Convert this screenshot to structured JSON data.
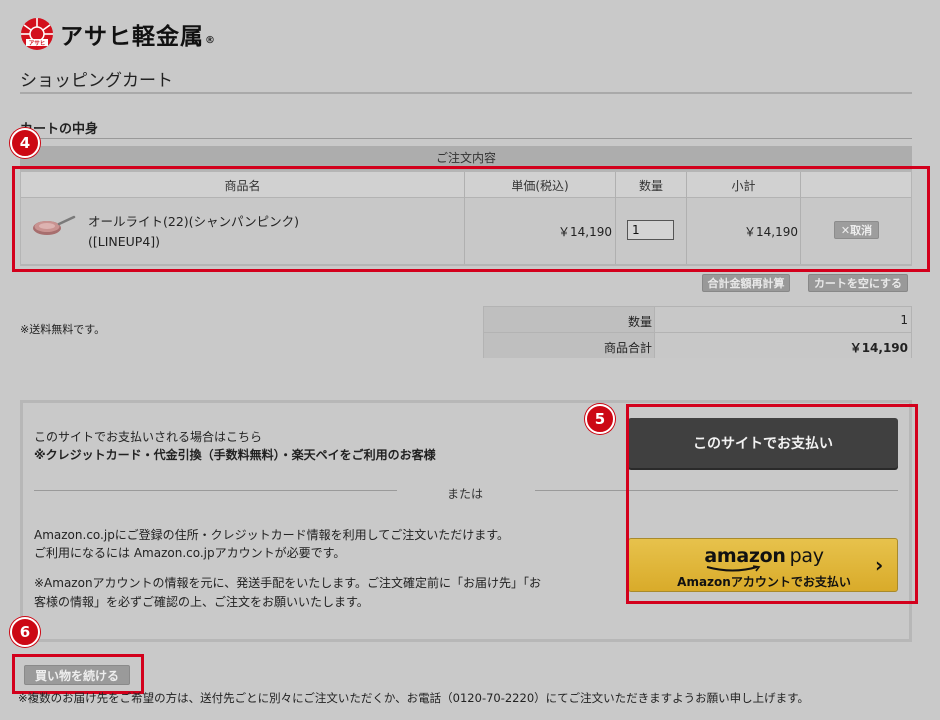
{
  "brand": {
    "logo_text": "アサヒ軽金属",
    "registered_mark": "®",
    "logo_mark_text": "アサヒ"
  },
  "page": {
    "title": "ショッピングカート",
    "section_title": "カートの中身"
  },
  "callouts": {
    "cart": "4",
    "payment": "5",
    "continue": "6"
  },
  "order": {
    "caption": "ご注文内容",
    "headers": {
      "name": "商品名",
      "unit_price": "単価(税込)",
      "quantity": "数量",
      "subtotal": "小計"
    },
    "item": {
      "name_line1": "オールライト(22)(シャンパンピンク)",
      "name_line2": "([LINEUP4])",
      "unit_price": "￥14,190",
      "quantity": "1",
      "subtotal": "￥14,190",
      "cancel_label": "✕取消"
    },
    "recalc_label": "合計金額再計算",
    "empty_cart_label": "カートを空にする"
  },
  "shipping_note": "※送料無料です。",
  "summary": {
    "quantity_label": "数量",
    "quantity_value": "1",
    "total_label": "商品合計",
    "total_value": "￥14,190"
  },
  "payment": {
    "site_intro": "このサイトでお支払いされる場合はこちら",
    "site_methods": "※クレジットカード・代金引換（手数料無料）・楽天ペイをご利用のお客様",
    "or_text": "または",
    "amazon_desc_1": "Amazon.co.jpにご登録の住所・クレジットカード情報を利用してご注文いただけます。",
    "amazon_desc_2": "ご利用になるには Amazon.co.jpアカウントが必要です。",
    "amazon_note_1": "※Amazonアカウントの情報を元に、発送手配をいたします。ご注文確定前に「お届け先」「お",
    "amazon_note_2": "客様の情報」を必ずご確認の上、ご注文をお願いいたします。",
    "site_pay_label": "このサイトでお支払い",
    "amazon_logo": "amazon",
    "amazon_logo_pay": "pay",
    "amazon_sub_label": "Amazonアカウントでお支払い",
    "amazon_chevron": "›"
  },
  "continue_label": "買い物を続ける",
  "footer_note": "※複数のお届け先をご希望の方は、送付先ごとに別々にご注文いただくか、お電話（0120-70-2220）にてご注文いただきますようお願い申し上げます。",
  "colors": {
    "accent_red": "#cc0814",
    "amazon_yellow": "#e7c24c",
    "dark_button": "#404040"
  }
}
